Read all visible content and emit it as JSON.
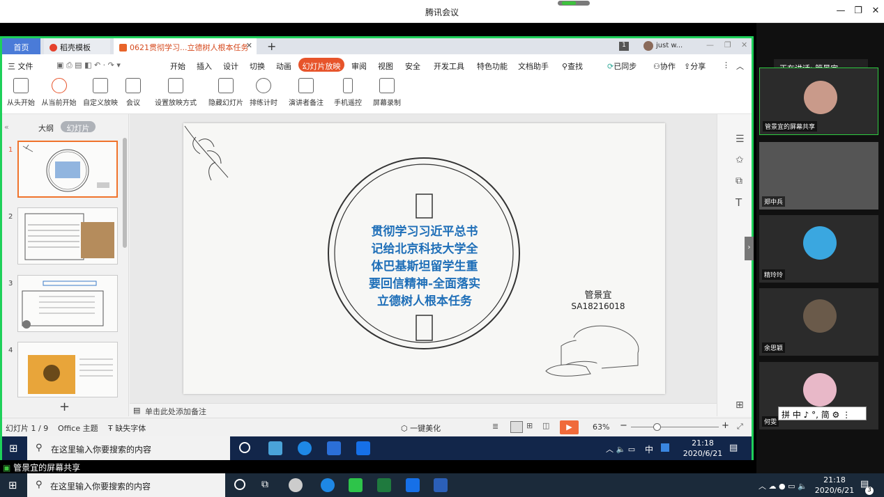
{
  "meeting": {
    "title": "腾讯会议",
    "speaking_label": "正在讲话: 管景宜",
    "share_label": "管景宜的屏幕共享"
  },
  "wps": {
    "tabs": [
      {
        "label": "首页"
      },
      {
        "label": "稻壳模板"
      },
      {
        "label": "0621贯彻学习...立德树人根本任务"
      }
    ],
    "add_tab": "+",
    "user_badge": "1",
    "user_name": "just w...",
    "menu_file": "三 文件",
    "menu": [
      "开始",
      "插入",
      "设计",
      "切换",
      "动画",
      "幻灯片放映",
      "审阅",
      "视图",
      "安全",
      "开发工具",
      "特色功能",
      "文档助手"
    ],
    "search": "查找",
    "sync": "已同步",
    "collab": "协作",
    "share": "分享",
    "ribbon": [
      "从头开始",
      "从当前开始",
      "自定义放映",
      "会议",
      "设置放映方式",
      "隐藏幻灯片",
      "排练计时",
      "演讲者备注",
      "手机遥控",
      "屏幕录制"
    ],
    "panel_tabs": [
      "大纲",
      "幻灯片"
    ],
    "thumb_numbers": [
      "1",
      "2",
      "3",
      "4"
    ],
    "notes_placeholder": "单击此处添加备注",
    "status": {
      "slide": "幻灯片 1 / 9",
      "theme": "Office 主题",
      "font": "缺失字体",
      "beautify": "一键美化",
      "zoom": "63%"
    }
  },
  "slide": {
    "title_lines": [
      "贯彻学习习近平总书",
      "记给北京科技大学全",
      "体巴基斯坦留学生重",
      "要回信精神-全面落实",
      "立德树人根本任务"
    ],
    "author": "管景宜",
    "student_id": "SA18216018"
  },
  "taskbar_inner": {
    "search": "在这里输入你要搜索的内容",
    "time": "21:18",
    "date": "2020/6/21",
    "ime": "中"
  },
  "taskbar_outer": {
    "search": "在这里输入你要搜索的内容",
    "time": "21:18",
    "date": "2020/6/21",
    "notif": "3"
  },
  "participants": [
    {
      "name": "管景宜的屏幕共享",
      "avatar_color": "#c99a8a"
    },
    {
      "name": "郑中兵",
      "avatar_color": "#777777"
    },
    {
      "name": "精玲玲",
      "avatar_color": "#3aa7e0"
    },
    {
      "name": "余思颖",
      "avatar_color": "#6a5a4a"
    },
    {
      "name": "何雯",
      "avatar_color": "#e8b8c8"
    }
  ],
  "ime_bar": "拼 中 ♪ °, 简 ⚙ ⋮",
  "colors": {
    "accent": "#e7542b",
    "share_border": "#1ed05a",
    "slide_title": "#1f6fb8",
    "wps_blue": "#4a7bd8"
  }
}
